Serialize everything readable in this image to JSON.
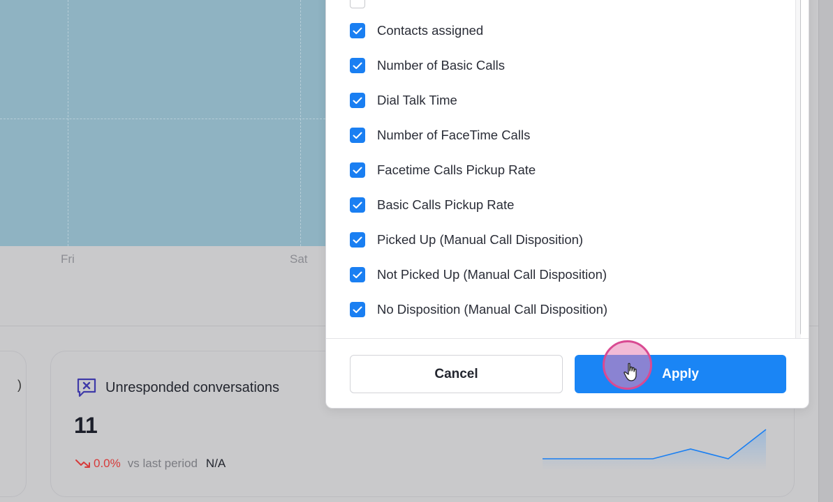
{
  "chart": {
    "x_ticks": [
      "Fri",
      "Sat"
    ]
  },
  "card_left": {
    "fragment": ")"
  },
  "card": {
    "title": "Unresponded conversations",
    "value": "11",
    "trend_pct": "0.0%",
    "trend_vs": "vs last period",
    "trend_na": "N/A",
    "icon": "message-x-icon",
    "sparkline_color": "#1a7ff2"
  },
  "modal": {
    "items": [
      {
        "label": "Contacts assigned",
        "checked": true
      },
      {
        "label": "Number of Basic Calls",
        "checked": true
      },
      {
        "label": "Dial Talk Time",
        "checked": true
      },
      {
        "label": "Number of FaceTime Calls",
        "checked": true
      },
      {
        "label": "Facetime Calls Pickup Rate",
        "checked": true
      },
      {
        "label": "Basic Calls Pickup Rate",
        "checked": true
      },
      {
        "label": "Picked Up (Manual Call Disposition)",
        "checked": true
      },
      {
        "label": "Not Picked Up (Manual Call Disposition)",
        "checked": true
      },
      {
        "label": "No Disposition (Manual Call Disposition)",
        "checked": true
      }
    ],
    "cancel_label": "Cancel",
    "apply_label": "Apply",
    "accent": "#1a85f5"
  }
}
